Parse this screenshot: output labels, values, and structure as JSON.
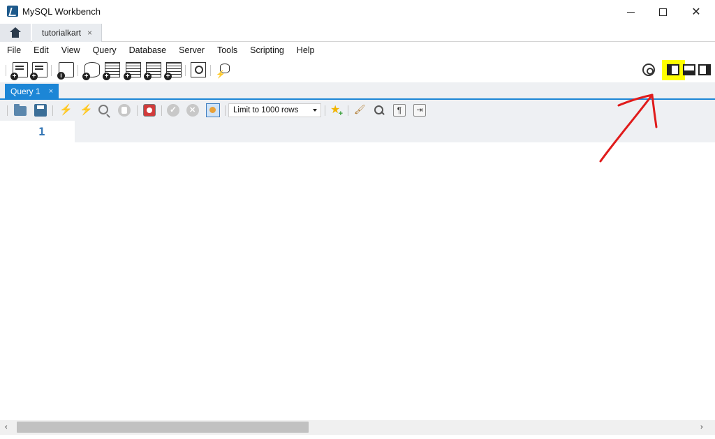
{
  "window": {
    "title": "MySQL Workbench",
    "minimize": "—",
    "maximize": "☐",
    "close": "✕"
  },
  "connection_tabs": {
    "active_tab": "tutorialkart",
    "close_glyph": "×"
  },
  "menu": [
    "File",
    "Edit",
    "View",
    "Query",
    "Database",
    "Server",
    "Tools",
    "Scripting",
    "Help"
  ],
  "main_toolbar": {
    "icons": [
      "new-sql-tab-icon",
      "open-sql-script-icon",
      "inspector-icon",
      "create-schema-icon",
      "create-table-icon",
      "create-view-icon",
      "create-procedure-icon",
      "create-function-icon",
      "search-table-data-icon",
      "reconnect-icon"
    ],
    "right_icons": [
      "settings-icon",
      "toggle-sidebar-icon",
      "toggle-output-icon",
      "toggle-secondary-sidebar-icon"
    ],
    "highlight_color": "#ffff00"
  },
  "query_tabs": {
    "active": "Query 1",
    "close_glyph": "×",
    "accent": "#1c86d6"
  },
  "sql_toolbar": {
    "limit_label": "Limit to 1000 rows",
    "pilcrow": "¶",
    "wrap": "⇥"
  },
  "editor": {
    "line_numbers": [
      "1"
    ],
    "line_number_color": "#3476b5"
  },
  "annotation": {
    "arrow_color": "#e01b1b"
  },
  "scrollbar": {
    "left_arrow": "‹",
    "right_arrow": "›"
  }
}
